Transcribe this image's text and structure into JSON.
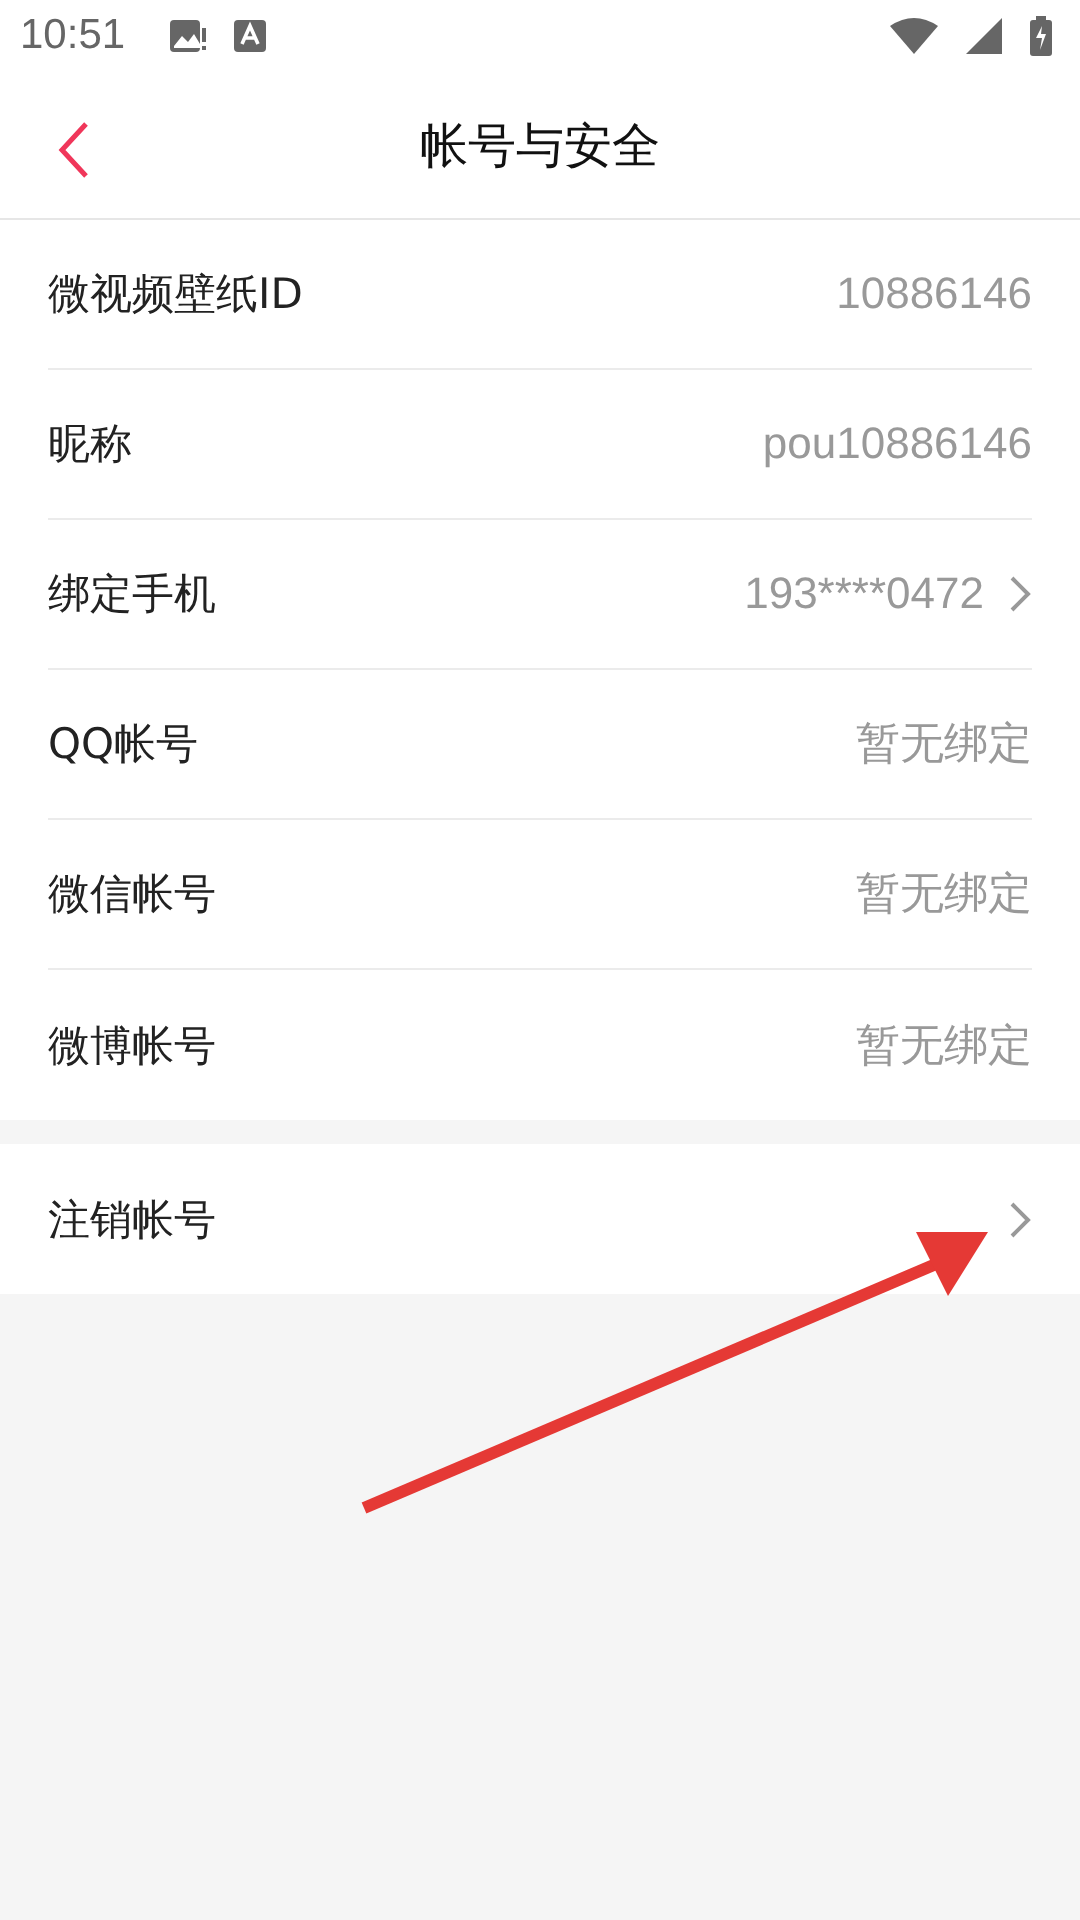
{
  "status_bar": {
    "time": "10:51"
  },
  "header": {
    "title": "帐号与安全"
  },
  "sections": [
    {
      "rows": [
        {
          "label": "微视频壁纸ID",
          "value": "10886146",
          "chevron": false
        },
        {
          "label": "昵称",
          "value": "pou10886146",
          "chevron": false
        },
        {
          "label": "绑定手机",
          "value": "193****0472",
          "chevron": true
        },
        {
          "label": "QQ帐号",
          "value": "暂无绑定",
          "chevron": false
        },
        {
          "label": "微信帐号",
          "value": "暂无绑定",
          "chevron": false
        },
        {
          "label": "微博帐号",
          "value": "暂无绑定",
          "chevron": false
        }
      ]
    },
    {
      "rows": [
        {
          "label": "注销帐号",
          "chevron": true
        }
      ]
    }
  ]
}
